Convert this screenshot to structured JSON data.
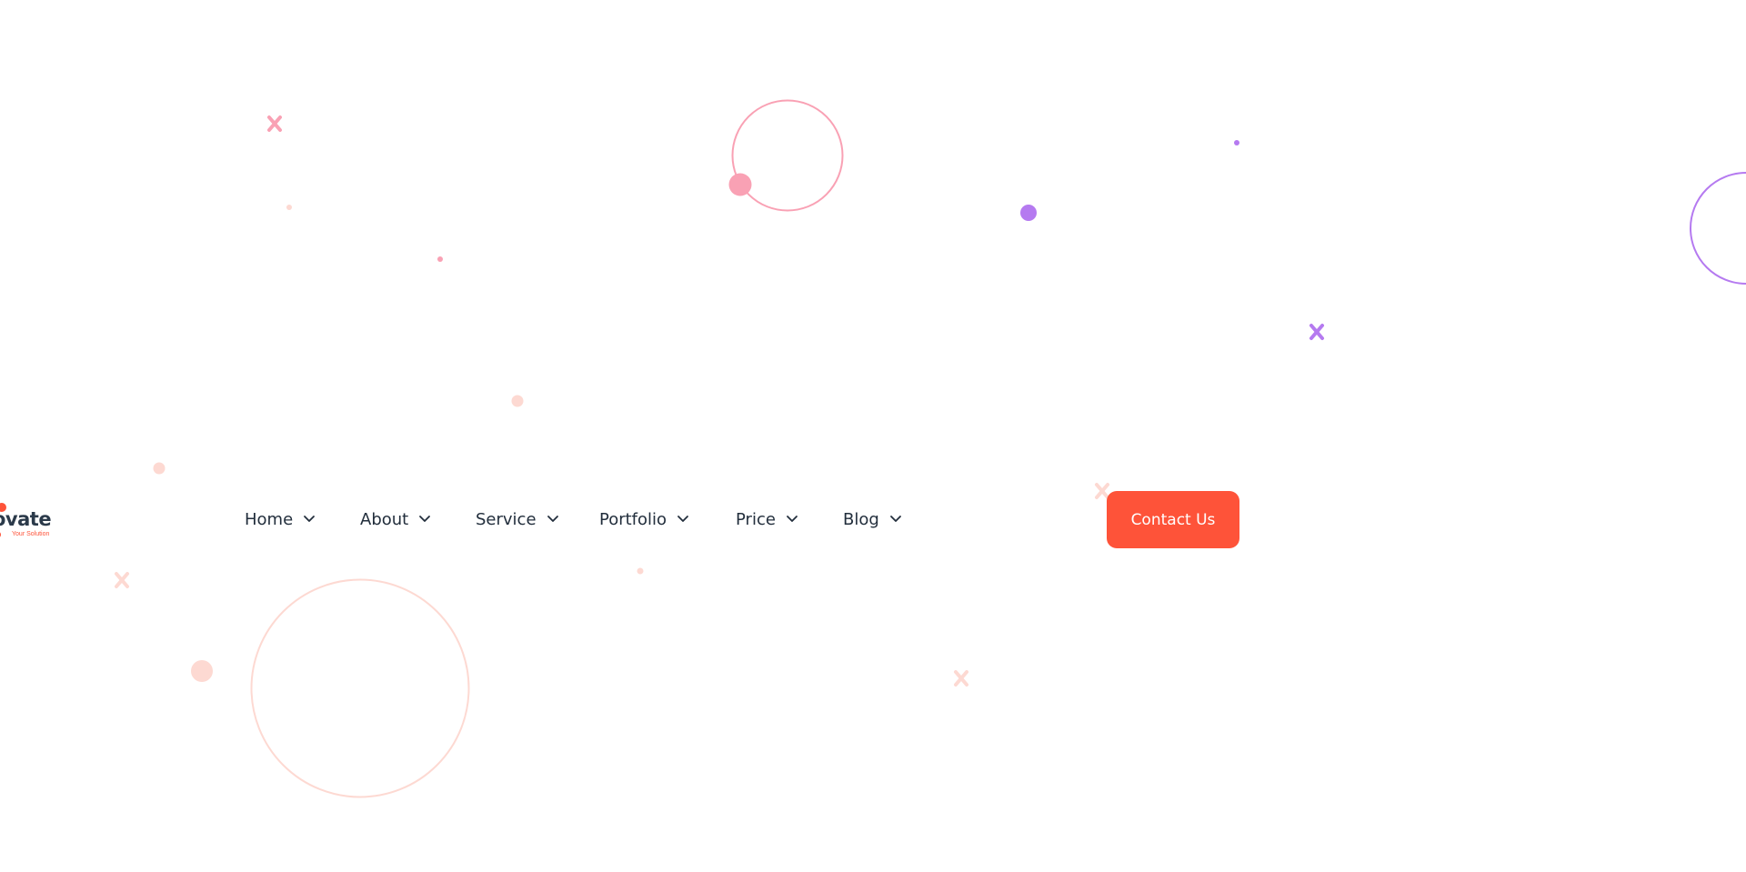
{
  "brand": {
    "word": "ovate",
    "tagline": "Your Solution",
    "accent_color": "#fe5339",
    "text_color": "#2b3a4a"
  },
  "nav": {
    "items": [
      {
        "label": "Home",
        "icon": "chevron-down-icon"
      },
      {
        "label": "About",
        "icon": "chevron-down-icon"
      },
      {
        "label": "Service",
        "icon": "chevron-down-icon"
      },
      {
        "label": "Portfolio",
        "icon": "chevron-down-icon"
      },
      {
        "label": "Price",
        "icon": "chevron-down-icon"
      },
      {
        "label": "Blog",
        "icon": "chevron-down-icon"
      }
    ]
  },
  "cta": {
    "label": "Contact Us",
    "color": "#fe5339"
  },
  "decoration_colors": {
    "pink": "#f9a1b4",
    "peach": "#fdd9d2",
    "purple": "#b57af0"
  }
}
